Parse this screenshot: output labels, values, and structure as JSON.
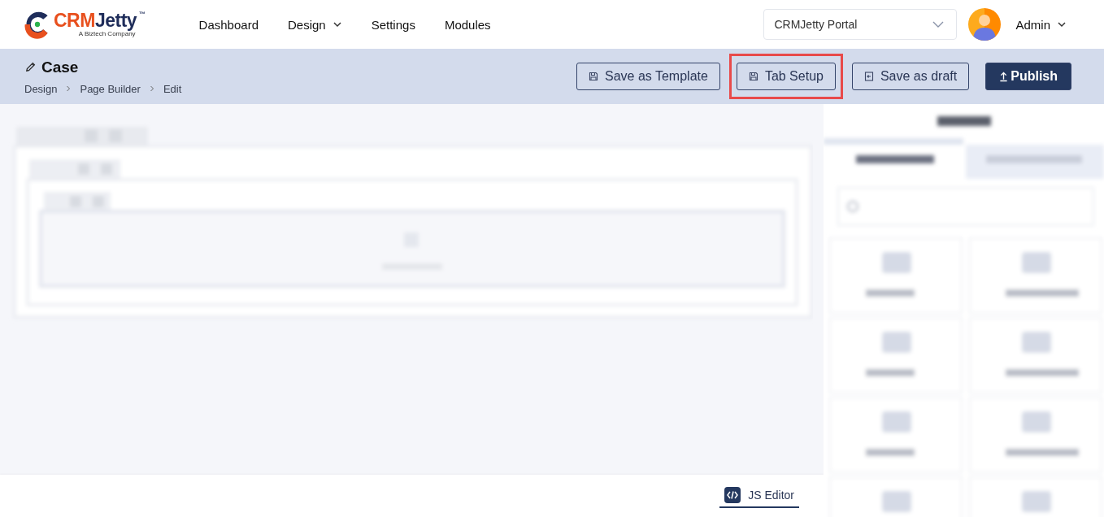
{
  "logo": {
    "parts": [
      {
        "text": "CRM",
        "color": "#e8501e"
      },
      {
        "text": "Jetty",
        "color": "#1f2d5a"
      }
    ],
    "mark": "™",
    "tagline": "A Biztech Company"
  },
  "nav": [
    {
      "label": "Dashboard",
      "has_menu": false
    },
    {
      "label": "Design",
      "has_menu": true
    },
    {
      "label": "Settings",
      "has_menu": false
    },
    {
      "label": "Modules",
      "has_menu": false
    }
  ],
  "portal_select": {
    "value": "CRMJetty Portal"
  },
  "user": {
    "name": "Admin"
  },
  "page": {
    "title": "Case",
    "breadcrumbs": [
      "Design",
      "Page Builder",
      "Edit"
    ]
  },
  "actions": [
    {
      "label": "Save as Template",
      "kind": "save",
      "highlighted": false
    },
    {
      "label": "Tab Setup",
      "kind": "save",
      "highlighted": true
    },
    {
      "label": "Save as draft",
      "kind": "draft",
      "highlighted": false
    },
    {
      "label": "Publish",
      "kind": "publish",
      "highlighted": false
    }
  ],
  "footer": {
    "js_editor": "JS Editor"
  }
}
